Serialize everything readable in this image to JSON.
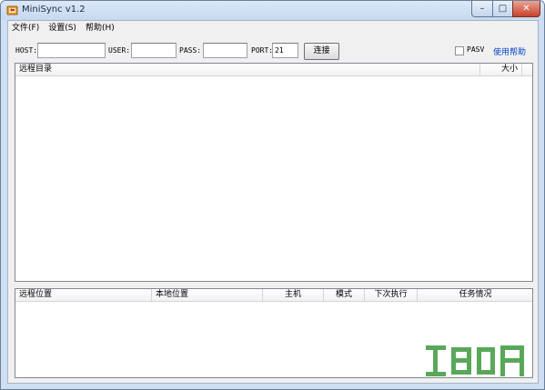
{
  "window": {
    "title": "MiniSync v1.2"
  },
  "menu": [
    {
      "label": "文件(F)"
    },
    {
      "label": "设置(S)"
    },
    {
      "label": "帮助(H)"
    }
  ],
  "connection": {
    "host_label": "HOST:",
    "host_value": "",
    "user_label": "USER:",
    "user_value": "",
    "pass_label": "PASS:",
    "pass_value": "",
    "port_label": "PORT:",
    "port_value": "21",
    "connect_button": "连接",
    "pasv_label": "PASV",
    "pasv_checked": false,
    "help_link": "使用帮助"
  },
  "remote_list": {
    "columns": [
      {
        "label": "远程目录"
      },
      {
        "label": "大小"
      }
    ],
    "rows": []
  },
  "task_list": {
    "columns": [
      {
        "label": "远程位置"
      },
      {
        "label": "本地位置"
      },
      {
        "label": "主机"
      },
      {
        "label": "模式"
      },
      {
        "label": "下次执行"
      },
      {
        "label": "任务情况"
      }
    ],
    "rows": []
  },
  "colors": {
    "accent_link": "#0044cc",
    "title_bar": "#cfdff2",
    "close_button": "#c7432c"
  }
}
